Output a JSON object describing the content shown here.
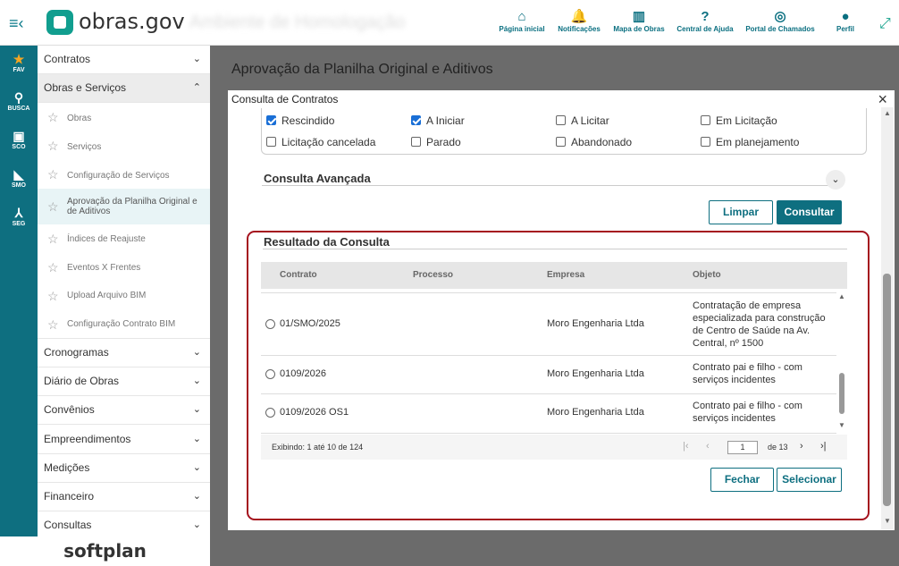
{
  "header": {
    "logo": "obras.gov",
    "env": "Ambiente de Homologação",
    "nav": [
      {
        "label": "Página inicial",
        "icon": "home-icon"
      },
      {
        "label": "Notificações",
        "icon": "bell-icon"
      },
      {
        "label": "Mapa de Obras",
        "icon": "map-icon"
      },
      {
        "label": "Central de Ajuda",
        "icon": "help-icon"
      },
      {
        "label": "Portal de Chamados",
        "icon": "lifebuoy-icon"
      },
      {
        "label": "Perfil",
        "icon": "user-icon"
      }
    ]
  },
  "rail": [
    {
      "label": "FAV"
    },
    {
      "label": "BUSCA"
    },
    {
      "label": "SCO"
    },
    {
      "label": "SMO"
    },
    {
      "label": "SEG"
    }
  ],
  "sidebar": {
    "sections": [
      "Contratos",
      "Obras e Serviços",
      "Cronogramas",
      "Diário de Obras",
      "Convênios",
      "Empreendimentos",
      "Medições",
      "Financeiro",
      "Consultas"
    ],
    "sub": [
      "Obras",
      "Serviços",
      "Configuração de Serviços",
      "Aprovação da Planilha Original e de Aditivos",
      "Índices de Reajuste",
      "Eventos X Frentes",
      "Upload Arquivo BIM",
      "Configuração Contrato BIM"
    ]
  },
  "brand": "softplan",
  "page_title": "Aprovação da Planilha Original e Aditivos",
  "modal": {
    "title": "Consulta de Contratos",
    "checks": [
      {
        "label": "Rescindido",
        "on": true
      },
      {
        "label": "A Iniciar",
        "on": true
      },
      {
        "label": "A Licitar",
        "on": false
      },
      {
        "label": "Em Licitação",
        "on": false
      },
      {
        "label": "Licitação cancelada",
        "on": false
      },
      {
        "label": "Parado",
        "on": false
      },
      {
        "label": "Abandonado",
        "on": false
      },
      {
        "label": "Em planejamento",
        "on": false
      }
    ],
    "advanced": "Consulta Avançada",
    "btn_clear": "Limpar",
    "btn_search": "Consultar",
    "result_title": "Resultado da Consulta",
    "columns": [
      "Contrato",
      "Processo",
      "Empresa",
      "Objeto"
    ],
    "rows": [
      {
        "contrato": "01/SMO/2025",
        "processo": "",
        "empresa": "Moro Engenharia Ltda",
        "objeto": "Contratação de empresa especializada para construção de Centro de Saúde na Av. Central, nº 1500"
      },
      {
        "contrato": "0109/2026",
        "processo": "",
        "empresa": "Moro Engenharia Ltda",
        "objeto": "Contrato pai e filho - com serviços incidentes"
      },
      {
        "contrato": "0109/2026 OS1",
        "processo": "",
        "empresa": "Moro Engenharia Ltda",
        "objeto": "Contrato pai e filho - com serviços incidentes"
      }
    ],
    "pager": {
      "info": "Exibindo: 1 até 10 de 124",
      "page": "1",
      "of": "de 13"
    },
    "btn_close": "Fechar",
    "btn_select": "Selecionar"
  }
}
